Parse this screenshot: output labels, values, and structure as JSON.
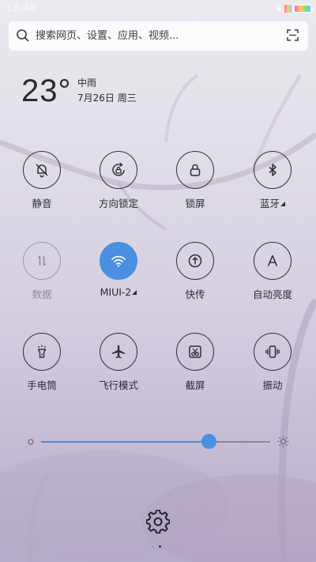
{
  "status_bar": {
    "time": "18:48"
  },
  "search": {
    "placeholder": "搜索网页、设置、应用、视频..."
  },
  "weather": {
    "temperature": "23°",
    "condition": "中雨",
    "date": "7月26日 周三"
  },
  "toggles": [
    {
      "label": "静音",
      "icon": "mute-bell-icon",
      "active": false
    },
    {
      "label": "方向锁定",
      "icon": "rotation-lock-icon",
      "active": false
    },
    {
      "label": "锁屏",
      "icon": "lock-icon",
      "active": false
    },
    {
      "label": "蓝牙",
      "icon": "bluetooth-icon",
      "active": false
    },
    {
      "label": "数据",
      "icon": "mobile-data-icon",
      "active": false
    },
    {
      "label": "MIUI-2",
      "icon": "wifi-icon",
      "active": true
    },
    {
      "label": "快传",
      "icon": "quick-transfer-icon",
      "active": false
    },
    {
      "label": "自动亮度",
      "icon": "auto-brightness-icon",
      "active": false
    },
    {
      "label": "手电筒",
      "icon": "flashlight-icon",
      "active": false
    },
    {
      "label": "飞行模式",
      "icon": "airplane-icon",
      "active": false
    },
    {
      "label": "截屏",
      "icon": "screenshot-icon",
      "active": false
    },
    {
      "label": "振动",
      "icon": "vibrate-icon",
      "active": false
    }
  ],
  "brightness": {
    "level_percent": 73
  },
  "pager": {
    "pages": 2,
    "current": 2
  },
  "colors": {
    "accent": "#4b8fe0",
    "icon_stroke": "#2f2f37",
    "dim": "#9a96a5"
  }
}
